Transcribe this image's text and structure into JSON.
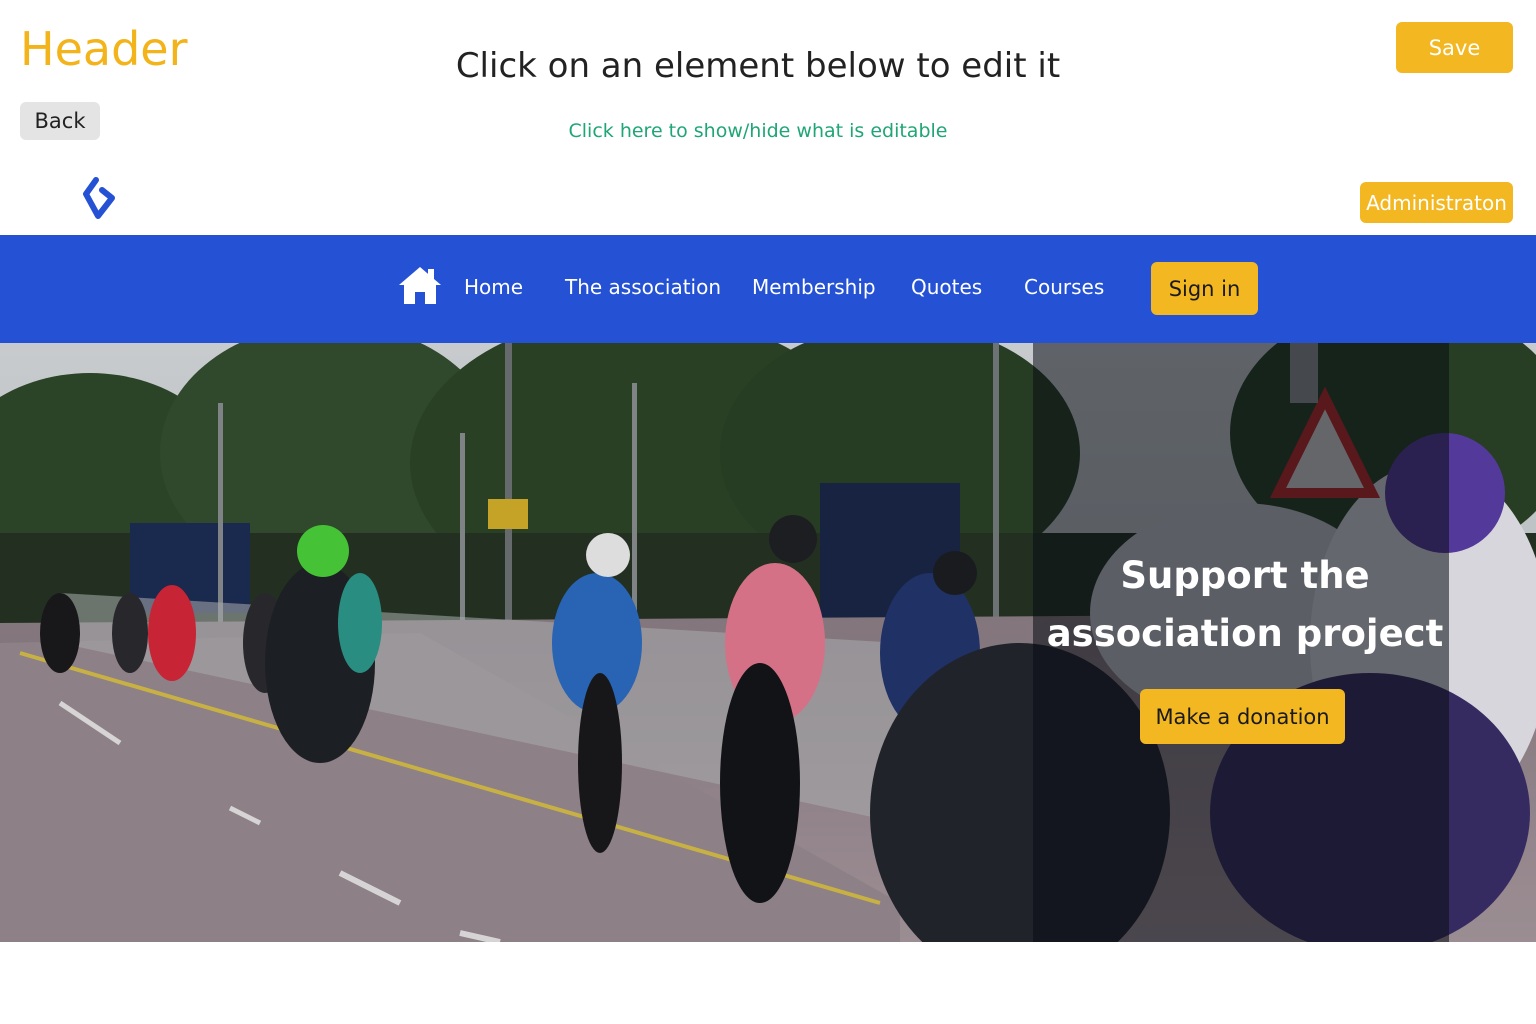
{
  "editor": {
    "title": "Header",
    "back_label": "Back",
    "instruction": "Click on an element below to edit it",
    "toggle_label": "Click here to show/hide what is editable",
    "save_label": "Save"
  },
  "site_header": {
    "logo_icon": "logo-icon",
    "admin_label": "Administraton"
  },
  "nav": {
    "home_icon": "home-icon",
    "items": [
      {
        "label": "Home"
      },
      {
        "label": "The association"
      },
      {
        "label": "Membership"
      },
      {
        "label": "Quotes"
      },
      {
        "label": "Courses"
      }
    ],
    "signin_label": "Sign in"
  },
  "hero": {
    "title_line1": "Support the",
    "title_line2": "association project",
    "donate_label": "Make a donation"
  },
  "colors": {
    "accent": "#f3b722",
    "nav_bg": "#2552d4",
    "link": "#20a676"
  }
}
